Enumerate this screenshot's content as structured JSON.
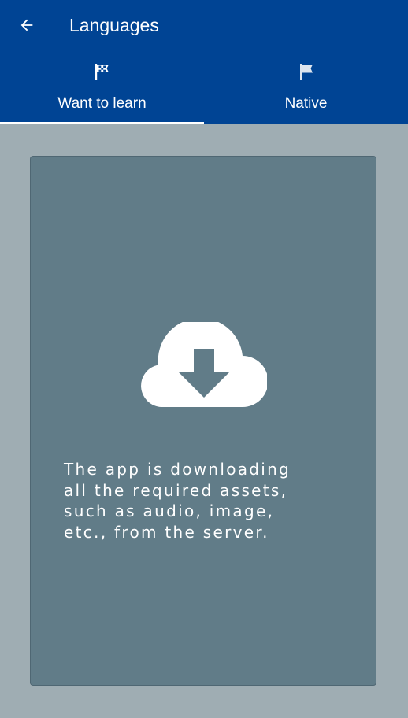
{
  "toolbar": {
    "title": "Languages",
    "back_icon": "arrow-back-icon"
  },
  "tabs": [
    {
      "label": "Want to learn",
      "icon": "checkered-flag-icon",
      "selected": true
    },
    {
      "label": "Native",
      "icon": "flag-icon",
      "selected": false
    }
  ],
  "download_card": {
    "icon": "cloud-download-icon",
    "message": "The app is downloading\nall the required assets,\nsuch as audio, image,\netc., from the server."
  },
  "colors": {
    "appbar": "#004494",
    "background": "#9fadb3",
    "card": "#617c88",
    "text": "#ffffff"
  }
}
